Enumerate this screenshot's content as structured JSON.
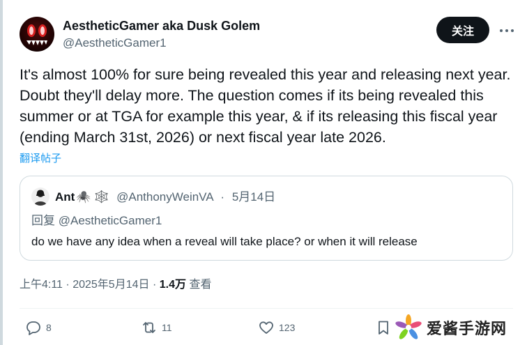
{
  "author": {
    "display_name": "AestheticGamer aka Dusk Golem",
    "handle": "@AestheticGamer1"
  },
  "follow_label": "关注",
  "more_icon": "more-horizontal-icon",
  "body": "It's almost 100% for sure being revealed this year and releasing next year. Doubt they'll delay more. The question comes if its being revealed this summer or at TGA for example this year, & if its releasing this fiscal year (ending March 31st, 2026) or next fiscal year late 2026.",
  "translate_label": "翻译帖子",
  "quote": {
    "display_name": "Ant",
    "name_emoji": "🕷️ 🕸️",
    "handle": "@AnthonyWeinVA",
    "separator": "·",
    "date": "5月14日",
    "reply_prefix": "回复",
    "reply_handle": "@AestheticGamer1",
    "text": "do we have any idea when a reveal will take place? or when it will release"
  },
  "meta": {
    "time": "上午4:11",
    "sep1": "·",
    "date": "2025年5月14日",
    "sep2": "·",
    "views_count": "1.4万",
    "views_label": "查看"
  },
  "actions": {
    "replies": "8",
    "reposts": "11",
    "likes": "123"
  },
  "watermark": {
    "text": "爱酱手游网"
  },
  "colors": {
    "text": "#0f1419",
    "secondary": "#536471",
    "link": "#1d9bf0",
    "follow_bg": "#0f1419",
    "border": "#cfd9de"
  }
}
